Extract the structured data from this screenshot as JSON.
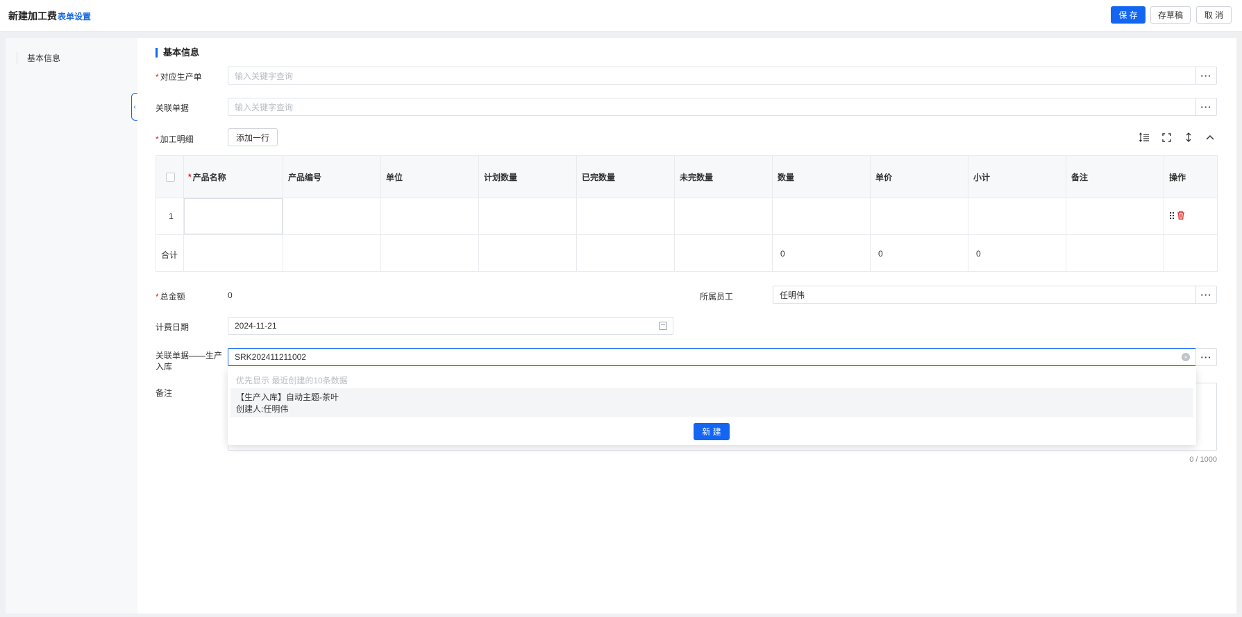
{
  "header": {
    "title": "新建加工费",
    "form_settings": "表单设置",
    "save_label": "保 存",
    "draft_label": "存草稿",
    "cancel_label": "取 消"
  },
  "sidebar": {
    "items": [
      {
        "label": "基本信息"
      }
    ]
  },
  "section": {
    "title": "基本信息"
  },
  "fields": {
    "production_order": {
      "label": "对应生产单",
      "required": true,
      "placeholder": "输入关键字查询",
      "value": ""
    },
    "related_doc": {
      "label": "关联单据",
      "placeholder": "输入关键字查询",
      "value": ""
    },
    "detail": {
      "label": "加工明细",
      "required": true,
      "add_row_label": "添加一行"
    },
    "total_amount": {
      "label": "总金额",
      "required": true,
      "value": "0"
    },
    "employee": {
      "label": "所属员工",
      "value": "任明伟"
    },
    "billing_date": {
      "label": "计费日期",
      "value": "2024-11-21"
    },
    "related_inbound": {
      "label_line1": "关联单据——生产",
      "label_line2": "入库",
      "value": "SRK202411211002"
    },
    "remark": {
      "label": "备注",
      "value": "",
      "counter": "0 / 1000"
    }
  },
  "table": {
    "columns": [
      "产品名称",
      "产品编号",
      "单位",
      "计划数量",
      "已完数量",
      "未完数量",
      "数量",
      "单价",
      "小计",
      "备注",
      "操作"
    ],
    "required_marker": "*",
    "rows": [
      {
        "index": "1",
        "cells": [
          "",
          "",
          "",
          "",
          "",
          "",
          "",
          "",
          "",
          ""
        ]
      }
    ],
    "total_row": {
      "label": "合计",
      "quantity": "0",
      "unit_price": "0",
      "subtotal": "0"
    }
  },
  "dropdown": {
    "hint": "优先显示 最近创建的10条数据",
    "options": [
      {
        "title": "【生产入库】自动主题-茶叶",
        "creator": "创建人:任明伟"
      }
    ],
    "new_label": "新 建"
  },
  "icons": [
    "row-height-icon",
    "fullscreen-icon",
    "vertical-expand-icon",
    "chevron-up-icon",
    "drag-handle-icon",
    "trash-icon",
    "calendar-icon",
    "clear-icon",
    "more-icon"
  ],
  "colors": {
    "primary": "#1266f1",
    "required": "#e02020",
    "danger": "#e02020"
  }
}
